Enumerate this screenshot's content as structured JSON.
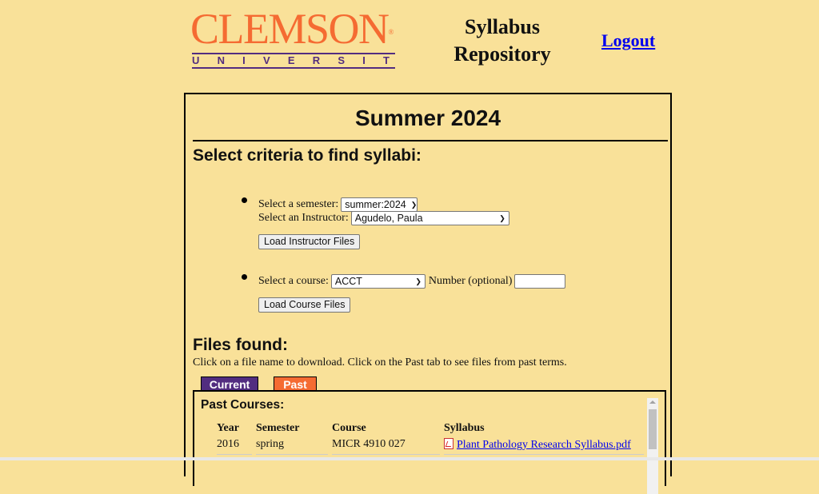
{
  "header": {
    "logo": {
      "wordmark": "CLEMSON",
      "registered": "®",
      "subtitle": "UNIVERSITY"
    },
    "app_title_line1": "Syllabus",
    "app_title_line2": "Repository",
    "logout_label": "Logout"
  },
  "panel": {
    "term_title": "Summer 2024",
    "criteria_title": "Select criteria to find syllabi:",
    "instructor_search": {
      "semester_label": "Select a semester:",
      "semester_value": "summer:2024",
      "instructor_label": "Select an Instructor:",
      "instructor_value": "Agudelo, Paula",
      "button_label": "Load Instructor Files"
    },
    "course_search": {
      "course_label": "Select a course:",
      "course_value": "ACCT",
      "number_label": "Number (optional)",
      "number_value": "",
      "button_label": "Load Course Files"
    },
    "files": {
      "title": "Files found:",
      "hint": "Click on a file name to download. Click on the Past tab to see files from past terms.",
      "tabs": [
        {
          "label": "Current",
          "color": "#522d80"
        },
        {
          "label": "Past",
          "color": "#f56b32"
        }
      ],
      "past_title": "Past Courses:",
      "columns": [
        "Year",
        "Semester",
        "Course",
        "Syllabus"
      ],
      "rows": [
        {
          "year": "2016",
          "semester": "spring",
          "course": "MICR 4910 027",
          "syllabus": "Plant Pathology Research Syllabus.pdf"
        }
      ]
    }
  },
  "colors": {
    "background": "#f9e199",
    "clemson_orange": "#f56b32",
    "clemson_purple": "#522d80",
    "link": "#0000ee"
  }
}
